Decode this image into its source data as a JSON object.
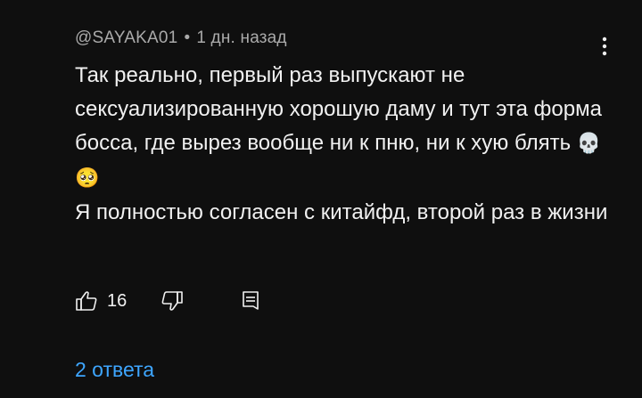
{
  "comment": {
    "author": "@SAYAKA01",
    "separator": "•",
    "time": "1 дн. назад",
    "text_main": "Так реально, первый раз выпускают не сексуализированную хорошую даму и тут эта форма босса, где вырез вообще ни к пню, ни к хую блять ",
    "emojis": "💀🥺",
    "text_second": "Я полностью согласен с китайфд, второй раз в жизни",
    "likes": "16",
    "replies_label": "2 ответа"
  },
  "icons": {
    "like": "thumbs-up-icon",
    "dislike": "thumbs-down-icon",
    "reply": "reply-icon",
    "menu": "more-vertical-icon"
  },
  "colors": {
    "background": "#0f0f0f",
    "text": "#f1f1f1",
    "meta": "#aaaaaa",
    "link": "#3ea6ff"
  }
}
